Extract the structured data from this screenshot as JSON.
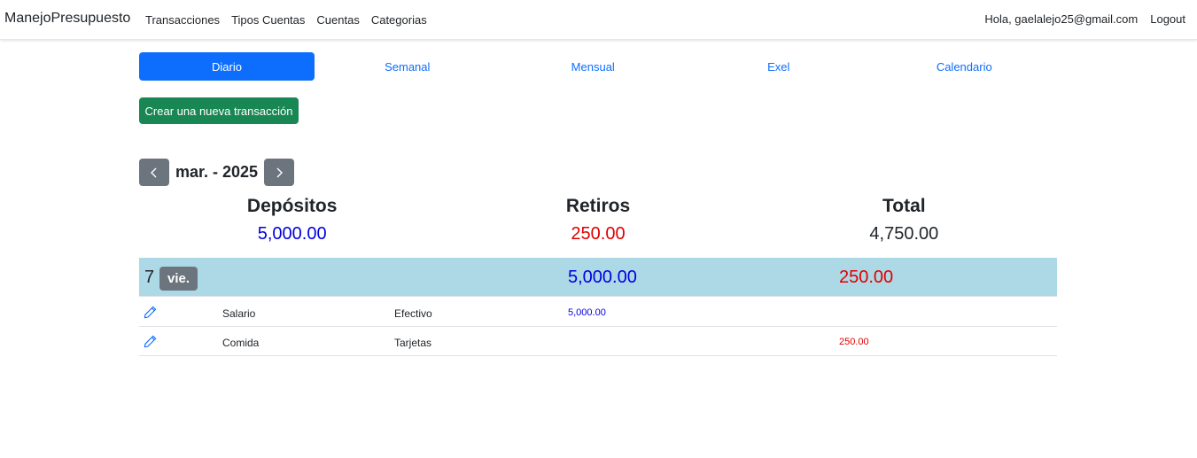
{
  "navbar": {
    "brand": "ManejoPresupuesto",
    "links": [
      "Transacciones",
      "Tipos Cuentas",
      "Cuentas",
      "Categorias"
    ],
    "greeting": "Hola, gaelalejo25@gmail.com",
    "logout": "Logout"
  },
  "tabs": [
    {
      "label": "Diario",
      "active": true
    },
    {
      "label": "Semanal",
      "active": false
    },
    {
      "label": "Mensual",
      "active": false
    },
    {
      "label": "Exel",
      "active": false
    },
    {
      "label": "Calendario",
      "active": false
    }
  ],
  "new_transaction_label": "Crear una nueva transacción",
  "month": {
    "label": "mar. - 2025",
    "prev_icon": "chevron-left-icon",
    "next_icon": "chevron-right-icon"
  },
  "summary": {
    "deposits_label": "Depósitos",
    "deposits_value": "5,000.00",
    "withdrawals_label": "Retiros",
    "withdrawals_value": "250.00",
    "total_label": "Total",
    "total_value": "4,750.00"
  },
  "day": {
    "number": "7",
    "weekday": "vie.",
    "deposits": "5,000.00",
    "withdrawals": "250.00",
    "transactions": [
      {
        "category": "Salario",
        "account": "Efectivo",
        "deposit": "5,000.00",
        "withdrawal": ""
      },
      {
        "category": "Comida",
        "account": "Tarjetas",
        "deposit": "",
        "withdrawal": "250.00"
      }
    ]
  },
  "colors": {
    "primary": "#0d6efd",
    "success": "#198754",
    "secondary": "#6c757d",
    "day_row_bg": "#add8e6",
    "deposit": "#0000e0",
    "withdrawal": "#e00000"
  }
}
